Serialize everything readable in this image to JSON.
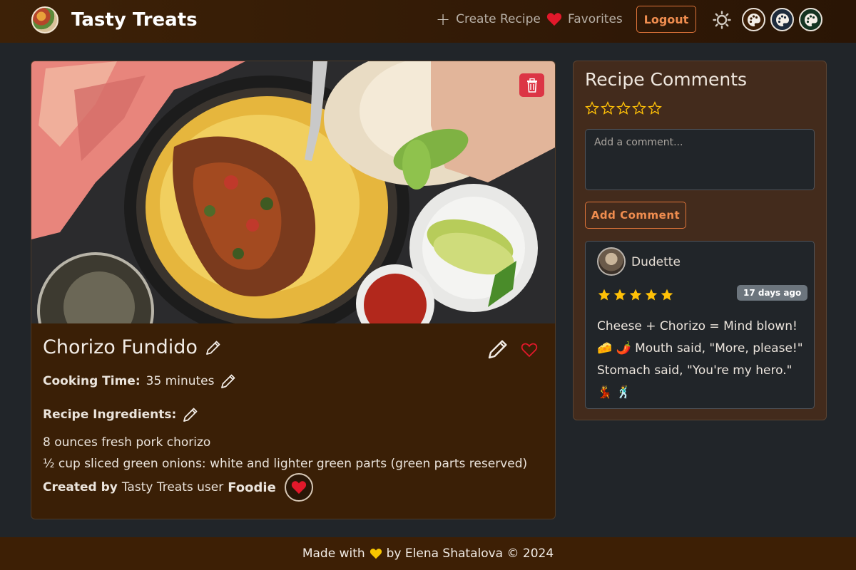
{
  "navbar": {
    "brand_title": "Tasty Treats",
    "create_label": "Create Recipe",
    "favorites_label": "Favorites",
    "logout_label": "Logout",
    "icons": [
      "plus-icon",
      "heart-icon",
      "sun-icon",
      "palette-icon"
    ]
  },
  "recipe": {
    "title": "Chorizo Fundido",
    "cooking_time_label": "Cooking Time:",
    "cooking_time_value": "35 minutes",
    "ingredients_label": "Recipe Ingredients:",
    "ingredients": [
      "8 ounces fresh pork chorizo",
      "½ cup sliced green onions: white and lighter green parts (green parts reserved)"
    ],
    "created_by_label": "Created by",
    "created_by_mid": "Tasty Treats user",
    "created_by_user": "Foodie"
  },
  "comments": {
    "title": "Recipe Comments",
    "rating_empty": 0,
    "placeholder": "Add a comment...",
    "add_label": "Add Comment",
    "items": [
      {
        "user": "Dudette",
        "rating": 5,
        "time": "17 days ago",
        "text": "Cheese + Chorizo = Mind blown! 🧀 🌶️ Mouth said, \"More, please!\" Stomach said, \"You're my hero.\" 💃 🕺"
      }
    ]
  },
  "footer": {
    "made_with": "Made with",
    "by_text": "by Elena Shatalova © 2024"
  },
  "colors": {
    "accent": "#f08d4f",
    "navbar": "#3d2107",
    "delete": "#dc3545",
    "star": "#ffc107",
    "heart": "#e2182a"
  }
}
